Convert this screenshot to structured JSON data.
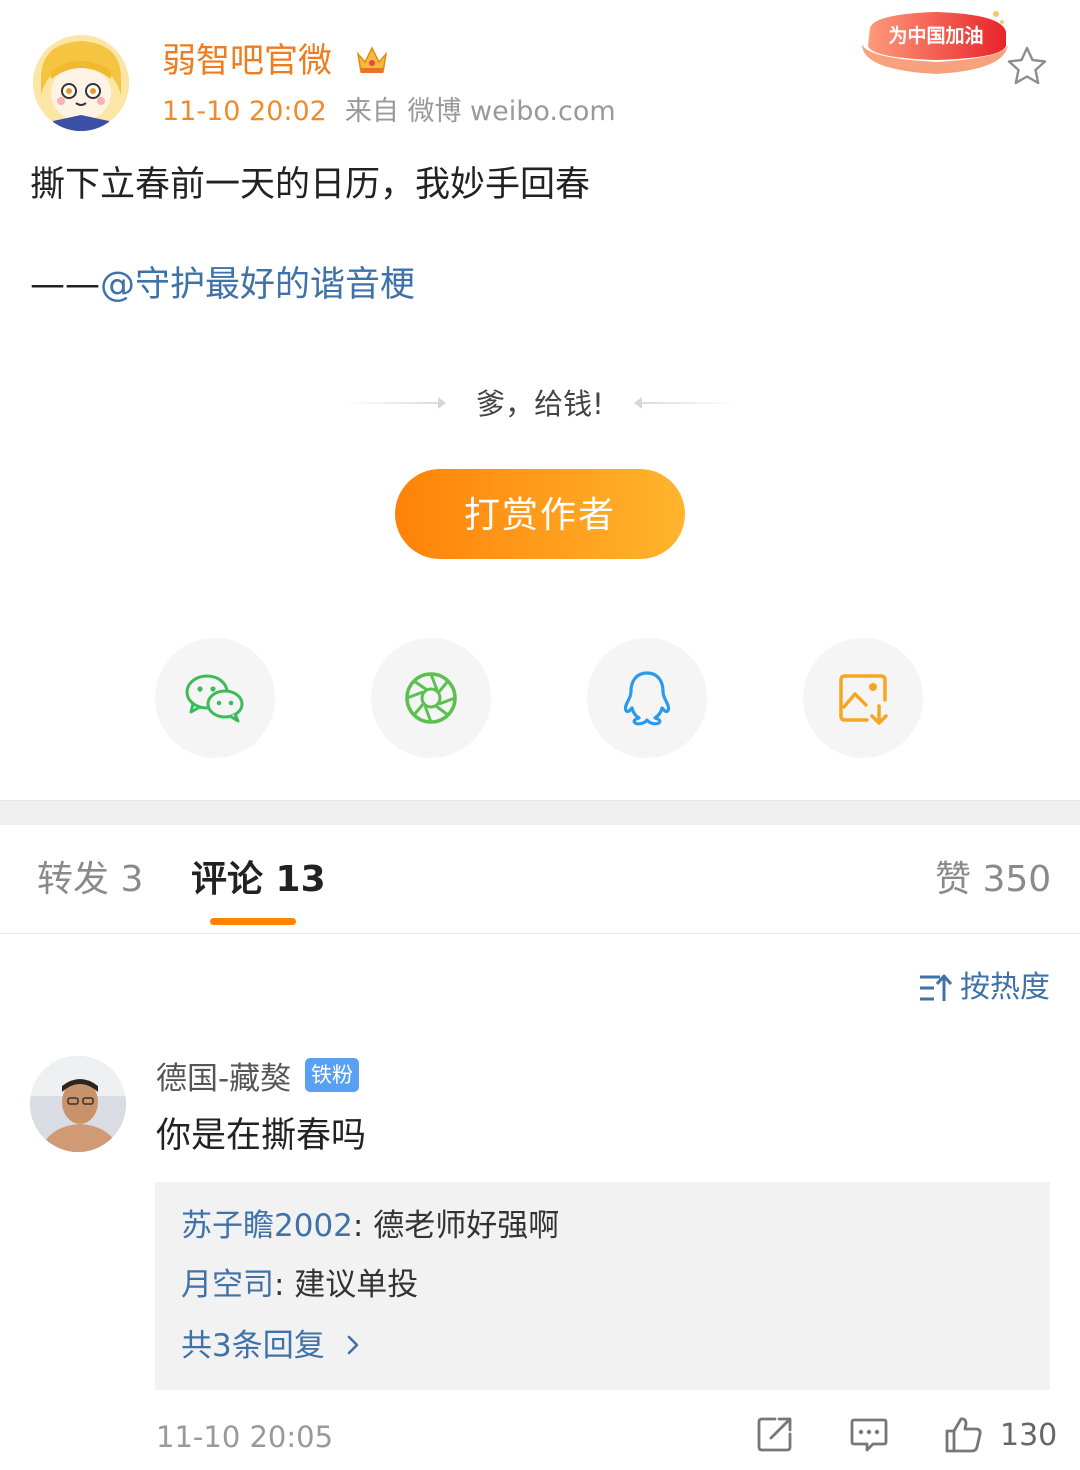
{
  "post": {
    "author": "弱智吧官微",
    "time": "11-10 20:02",
    "source": "来自 微博 weibo.com",
    "banner_text": "为中国加油",
    "text": "撕下立春前一天的日历，我妙手回春",
    "attribution_prefix": "——",
    "attribution_mention": "@守护最好的谐音梗"
  },
  "reward": {
    "caption": "爹，给钱!",
    "button_label": "打赏作者"
  },
  "share": {
    "icons": [
      "wechat-icon",
      "moments-icon",
      "qq-icon",
      "save-image-icon"
    ],
    "colors": {
      "wechat": "#3dbb5b",
      "moments": "#5cc04e",
      "qq": "#2b9aee",
      "save": "#f5a623"
    }
  },
  "tabs": {
    "repost": "转发 3",
    "comments": "评论 13",
    "likes": "赞 350"
  },
  "sort_label": "按热度",
  "comment": {
    "author": "德国-藏獒",
    "badge": "铁粉",
    "text": "你是在撕春吗",
    "replies": [
      {
        "name": "苏子瞻2002",
        "text": ": 德老师好强啊"
      },
      {
        "name": "月空司",
        "text": ": 建议单投"
      }
    ],
    "more_replies": "共3条回复",
    "time": "11-10 20:05",
    "likes": "130"
  },
  "colors": {
    "accent": "#ff8200",
    "link": "#3f72a8",
    "username": "#f27b1d"
  }
}
